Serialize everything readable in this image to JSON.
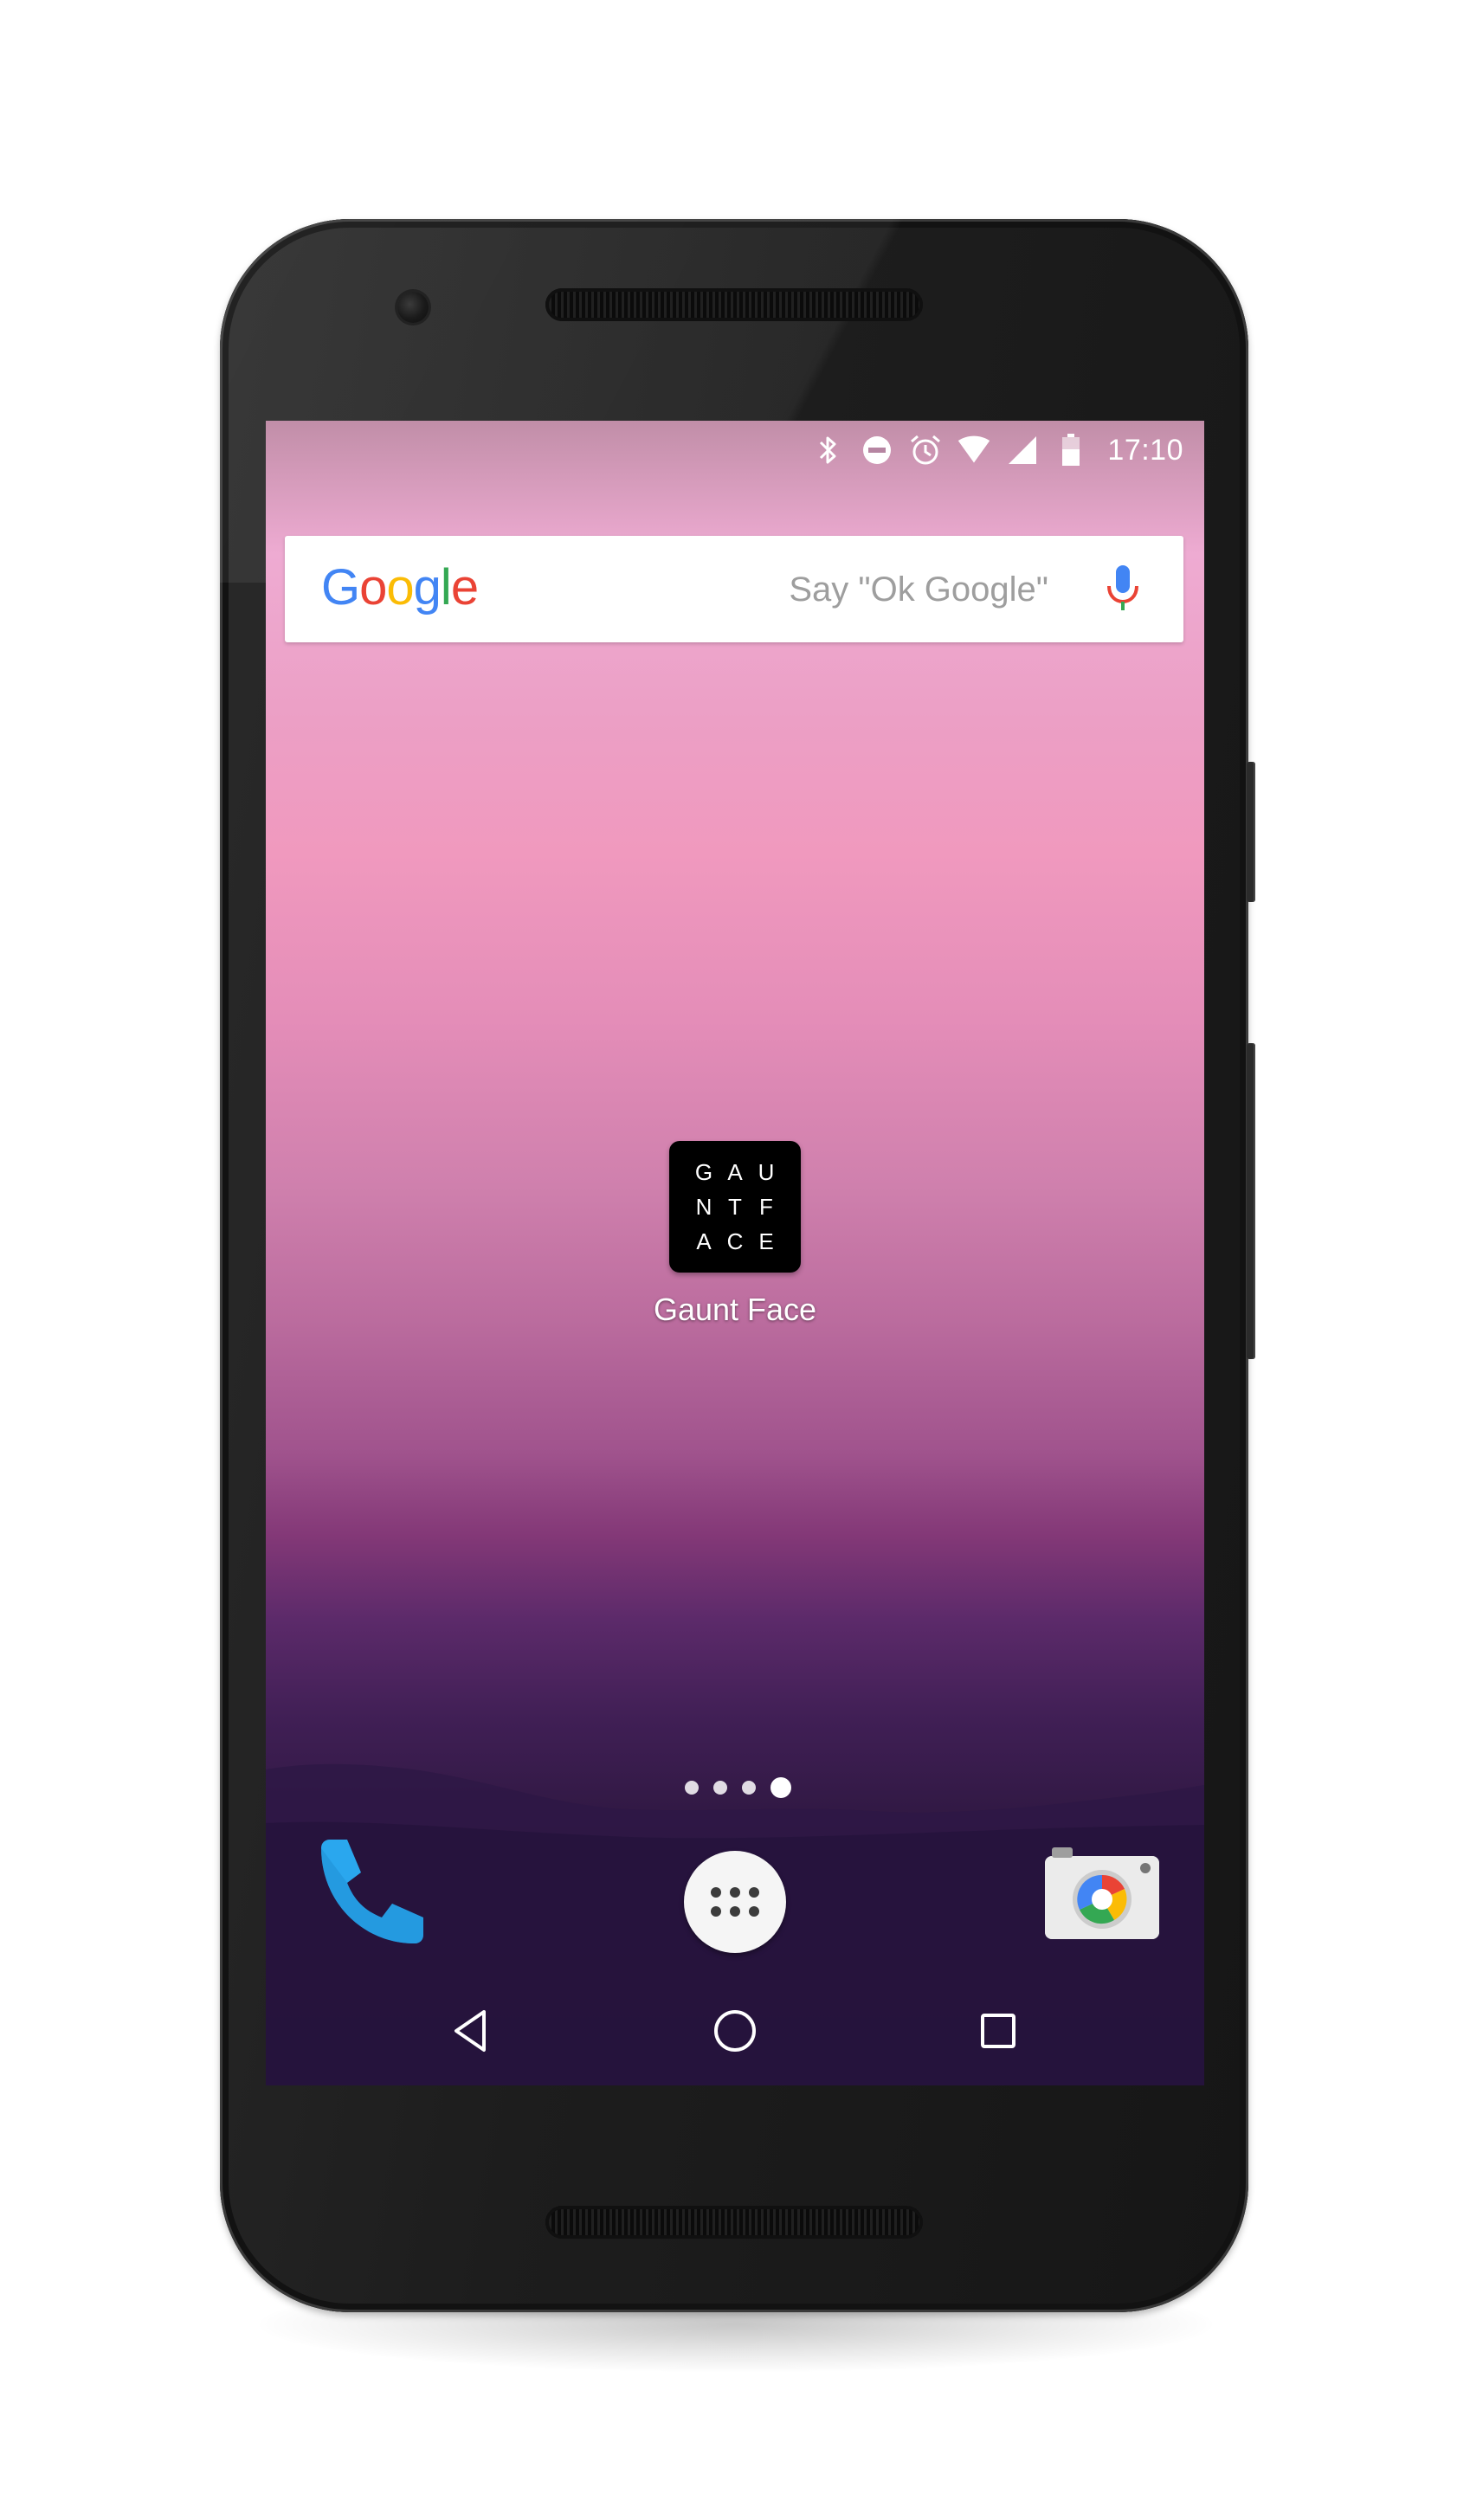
{
  "status_bar": {
    "icons": [
      "bluetooth-icon",
      "do-not-disturb-icon",
      "alarm-icon",
      "wifi-icon",
      "cell-signal-icon",
      "battery-icon"
    ],
    "time": "17:10"
  },
  "search_widget": {
    "logo_letters": [
      "G",
      "o",
      "o",
      "g",
      "l",
      "e"
    ],
    "logo_colors": [
      "#4285F4",
      "#EA4335",
      "#FBBC05",
      "#4285F4",
      "#34A853",
      "#EA4335"
    ],
    "hint": "Say \"Ok Google\"",
    "mic_icon": "mic-icon"
  },
  "home_screen": {
    "app": {
      "icon_letters": [
        "G",
        "A",
        "U",
        "N",
        "T",
        "F",
        "A",
        "C",
        "E"
      ],
      "label": "Gaunt Face"
    },
    "page_indicator": {
      "pages": 4,
      "current": 4
    }
  },
  "dock": {
    "items": [
      "phone-icon",
      "app-drawer-icon",
      "camera-icon"
    ]
  },
  "nav_bar": {
    "buttons": [
      "back-icon",
      "home-icon",
      "recents-icon"
    ]
  }
}
